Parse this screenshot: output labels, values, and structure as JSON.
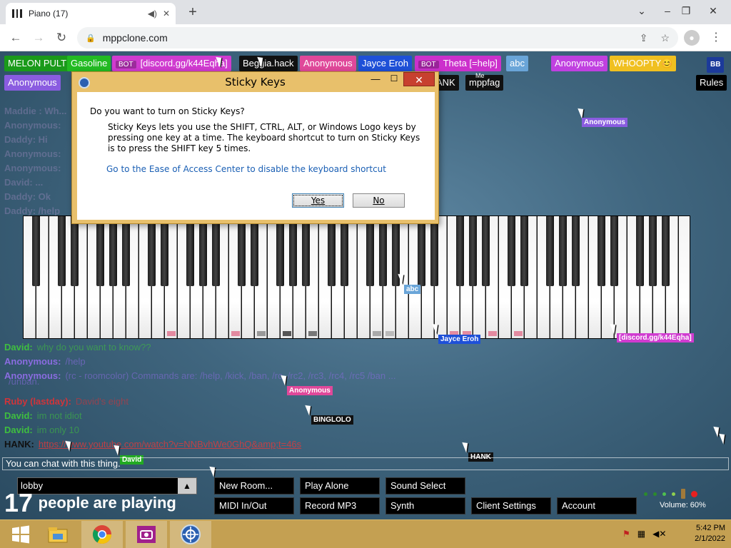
{
  "browser": {
    "tab_title": "Piano (17)",
    "new_tab": "+",
    "url": "mppclone.com",
    "window": {
      "minimize": "–",
      "restore": "❐",
      "close": "✕"
    }
  },
  "players": [
    {
      "name": "MELON PULT",
      "color": "#1a9a1a",
      "text": "#fff"
    },
    {
      "name": "Gasoline",
      "color": "#22bb22",
      "text": "#fff"
    },
    {
      "name": "[discord.gg/k44Eqha]",
      "color": "#d03bd0",
      "text": "#fff",
      "bot": "BOT"
    },
    {
      "name": "Beggia.hack",
      "color": "#111111",
      "text": "#fff"
    },
    {
      "name": "Anonymous",
      "color": "#e0489a",
      "text": "#fff"
    },
    {
      "name": "Jayce Eroh",
      "color": "#1e50d8",
      "text": "#fff"
    },
    {
      "name": "Theta [=help]",
      "color": "#cc30cc",
      "text": "#fff",
      "bot": "BOT"
    },
    {
      "name": "abc",
      "color": "#6aa5d8",
      "text": "#fff"
    },
    {
      "name": "Anonymous",
      "color": "#c040e0",
      "text": "#fff"
    },
    {
      "name": "WHOOPTY😊",
      "color": "#f0c020",
      "text": "#fff"
    }
  ],
  "players_row2": [
    {
      "name": "Anonymous",
      "color": "#8a5ce0",
      "text": "#fff"
    },
    {
      "name": "ANK",
      "color": "#111111",
      "text": "#fff"
    },
    {
      "name": "mppfag",
      "color": "#111111",
      "text": "#fff",
      "sup": "Me"
    }
  ],
  "top_right": {
    "rules": "Rules",
    "logo": "BB"
  },
  "chat": [
    {
      "user": "David:",
      "msg": "why do you want to know??",
      "color": "#3fbf3f"
    },
    {
      "user": "Anonymous:",
      "msg": "/help",
      "color": "#8a6ce0"
    },
    {
      "user": "Anonymous:",
      "msg": "(rc - roomcolor) Commands are: /help, /kick, /ban, /rc, /rc2, /rc3, /rc4, /rc5 /ban ...",
      "color": "#8a6ce0"
    },
    {
      "user": "",
      "msg": "/unban.",
      "color": "#8a6ce0"
    },
    {
      "user": "Ruby (lastday):",
      "msg": "David's eight",
      "color": "#d0343a"
    },
    {
      "user": "David:",
      "msg": "im not idiot",
      "color": "#3fbf3f"
    },
    {
      "user": "David:",
      "msg": "im only 10",
      "color": "#3fbf3f"
    },
    {
      "user": "HANK:",
      "msg": "https://www.youtube.com/watch?v=NNBvhWe0GhQ&amp;t=46s",
      "color": "#111111"
    }
  ],
  "chat_faded": [
    "Maddie : Wh...",
    "Anonymous:",
    "Daddy: Hi",
    "Anonymous:",
    "Anonymous:",
    "David: ...",
    "Daddy: Ok",
    "Daddy: /help"
  ],
  "cursor_labels": [
    {
      "name": "Anonymous",
      "color": "#8a5ce0"
    },
    {
      "name": "abc",
      "color": "#6aa5d8"
    },
    {
      "name": "Jayce Eroh",
      "color": "#1e50d8"
    },
    {
      "name": "[discord.gg/k44Eqha]",
      "color": "#d03bd0"
    },
    {
      "name": "Anonymous",
      "color": "#e0489a"
    },
    {
      "name": "BINGLOLO",
      "color": "#111111"
    },
    {
      "name": "HANK",
      "color": "#111111"
    },
    {
      "name": "David",
      "color": "#22aa22"
    }
  ],
  "chat_input_placeholder": "You can chat with this thing.",
  "room": {
    "name": "lobby",
    "arrow": "▲"
  },
  "player_count": {
    "number": "17",
    "label": "people are playing"
  },
  "controls": {
    "new_room": "New Room...",
    "play_alone": "Play Alone",
    "sound_select": "Sound Select",
    "midi": "MIDI In/Out",
    "record": "Record MP3",
    "synth": "Synth",
    "client_settings": "Client Settings",
    "account": "Account"
  },
  "volume": {
    "label": "Volume: 60%",
    "level": 0.6
  },
  "dialog": {
    "title": "Sticky Keys",
    "question": "Do you want to turn on Sticky Keys?",
    "description": "Sticky Keys lets you use the SHIFT, CTRL, ALT, or Windows Logo keys by pressing one key at a time. The keyboard shortcut to turn on Sticky Keys is to press the SHIFT key 5 times.",
    "link": "Go to the Ease of Access Center to disable the keyboard shortcut",
    "yes": "Yes",
    "no": "No",
    "minimize": "—",
    "maximize": "☐",
    "close": "✕"
  },
  "taskbar": {
    "time": "5:42 PM",
    "date": "2/1/2022",
    "apps": [
      "windows-start",
      "file-explorer",
      "chrome",
      "camera",
      "accessibility"
    ]
  }
}
